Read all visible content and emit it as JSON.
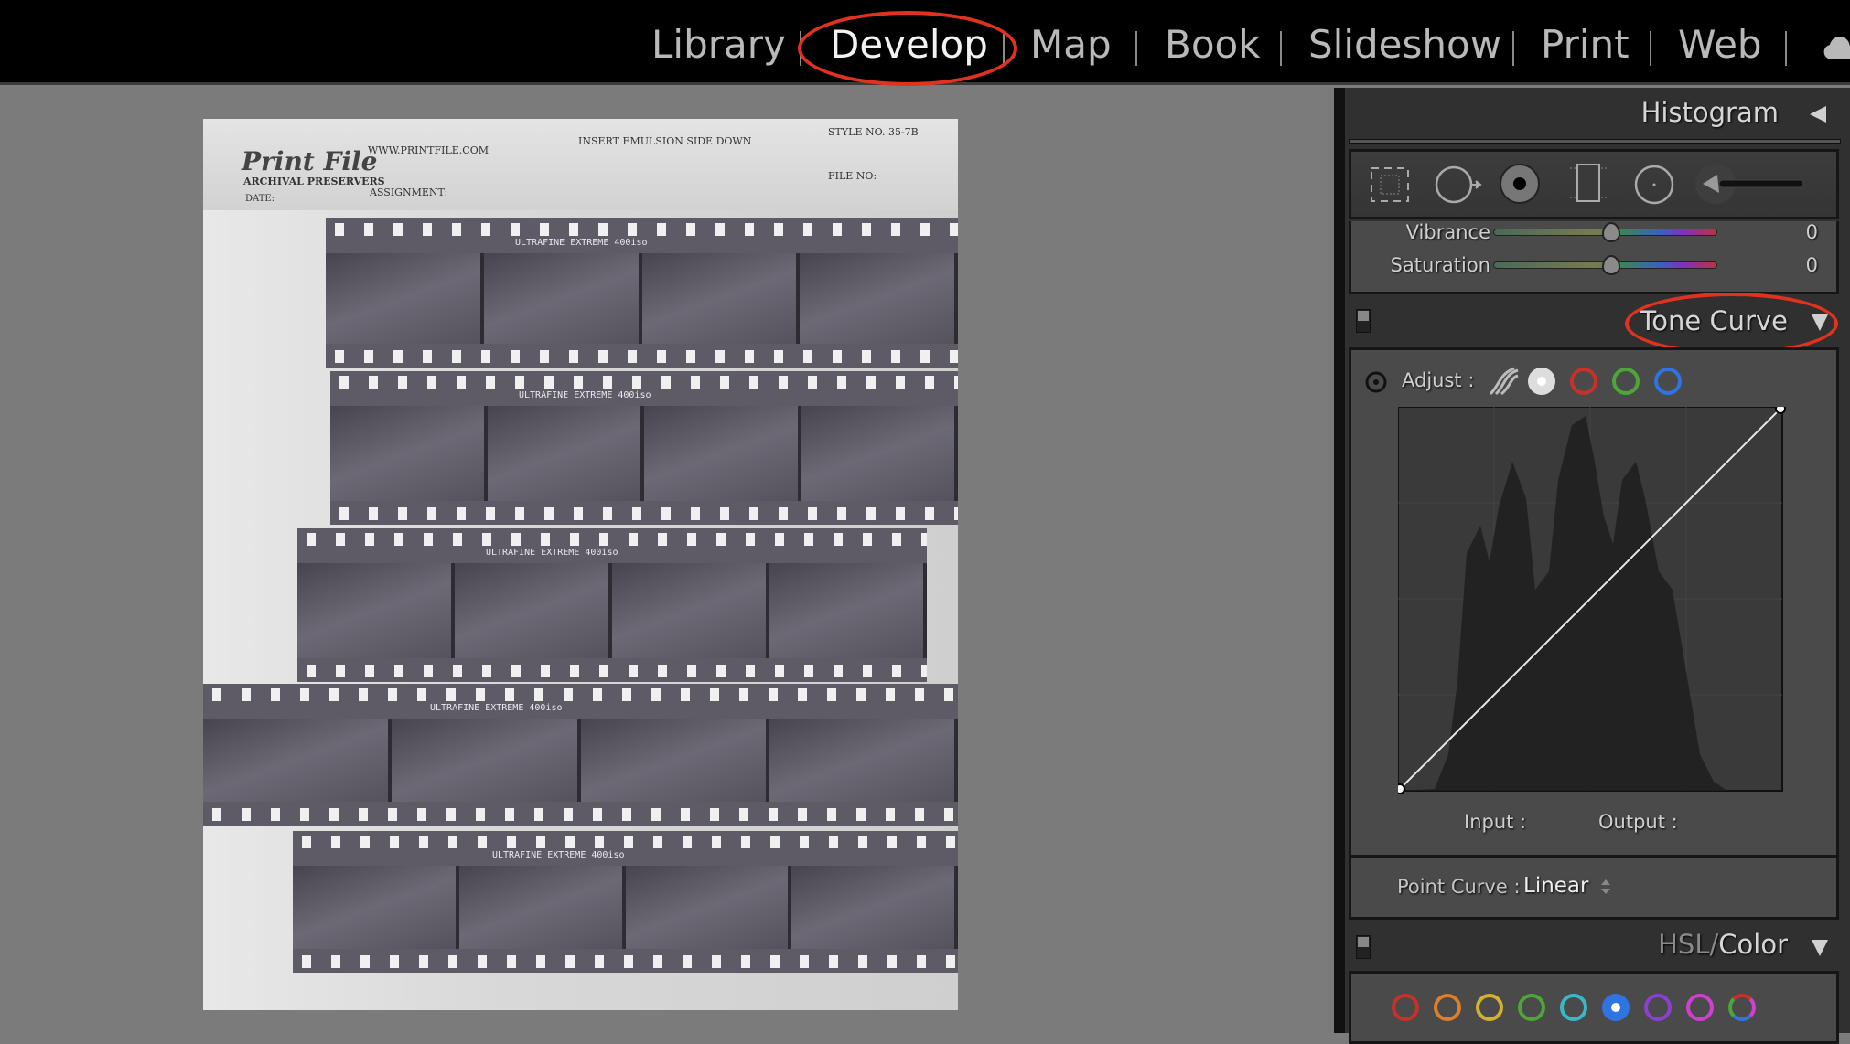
{
  "modules": [
    {
      "label": "Library",
      "active": false
    },
    {
      "label": "Develop",
      "active": true
    },
    {
      "label": "Map",
      "active": false
    },
    {
      "label": "Book",
      "active": false
    },
    {
      "label": "Slideshow",
      "active": false
    },
    {
      "label": "Print",
      "active": false
    },
    {
      "label": "Web",
      "active": false
    }
  ],
  "cloud_icon": "cloud-icon",
  "annotation_color": "#e0321f",
  "photo": {
    "brand": "Print File",
    "brand_sub": "ARCHIVAL PRESERVERS",
    "url": "WWW.PRINTFILE.COM",
    "instruction": "INSERT EMULSION SIDE DOWN",
    "style": "STYLE NO. 35-7B",
    "file": "FILE NO:",
    "date": "DATE:",
    "assignment": "ASSIGNMENT:",
    "film": "ULTRAFINE EXTREME 400iso"
  },
  "panel": {
    "histogram_title": "Histogram",
    "tools": [
      "crop-overlay-icon",
      "spot-removal-icon",
      "red-eye-icon",
      "graduated-filter-icon",
      "radial-filter-icon",
      "adjustment-brush-icon"
    ],
    "basic": {
      "vibrance_label": "Vibrance",
      "vibrance_value": "0",
      "saturation_label": "Saturation",
      "saturation_value": "0"
    },
    "tone_curve": {
      "title": "Tone Curve",
      "adjust_label": "Adjust :",
      "channels": [
        "parametric",
        "rgb",
        "red",
        "green",
        "blue"
      ],
      "input_label": "Input :",
      "output_label": "Output :",
      "point_curve_label": "Point Curve :",
      "point_curve_value": "Linear"
    },
    "hsl": {
      "title_hsl": "HSL",
      "title_sep": "/",
      "title_color": "Color",
      "swatches": [
        "#c8302c",
        "#d97f2e",
        "#d4b22e",
        "#4fa53a",
        "#3ab8c8",
        "#2f74e0",
        "#8a40d0",
        "#d040d0",
        "mixed"
      ],
      "selected_swatch": 5
    }
  }
}
